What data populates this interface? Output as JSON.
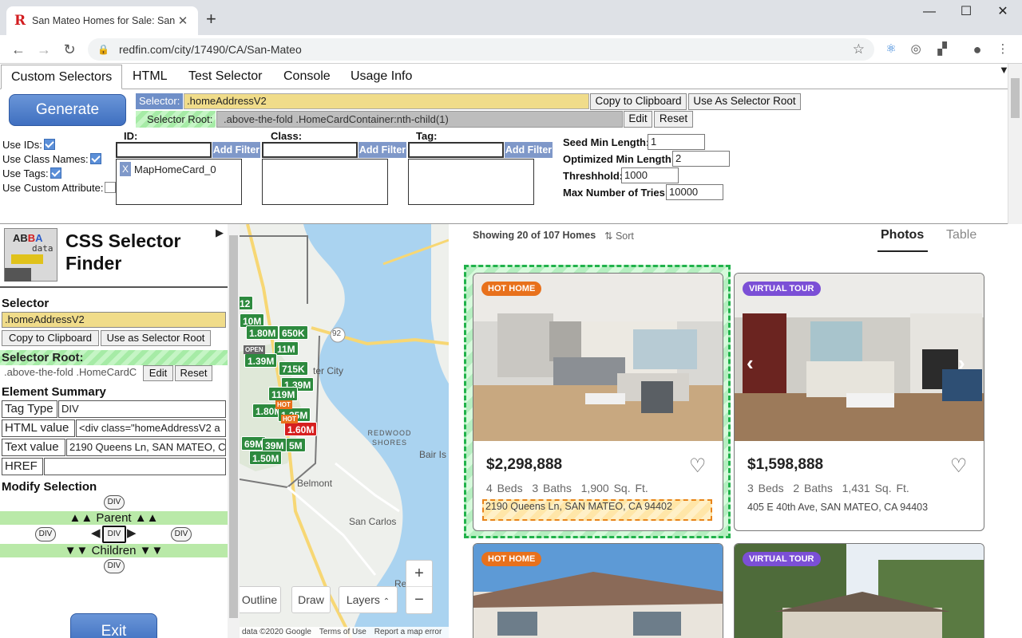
{
  "browser": {
    "tab_title": "San Mateo Homes for Sale: San M",
    "favicon": "R",
    "url": "redfin.com/city/17490/CA/San-Mateo"
  },
  "ext": {
    "tabs": [
      "Custom Selectors",
      "HTML",
      "Test Selector",
      "Console",
      "Usage Info"
    ],
    "generate_label": "Generate",
    "selector_label": "Selector:",
    "selector_value": ".homeAddressV2",
    "copy_label": "Copy to Clipboard",
    "use_root_label": "Use As Selector Root",
    "root_label": "Selector Root:",
    "root_value": ".above-the-fold .HomeCardContainer:nth-child(1)",
    "edit_label": "Edit",
    "reset_label": "Reset",
    "use_ids": "Use IDs:",
    "use_class_names": "Use Class Names:",
    "use_tags": "Use Tags:",
    "use_custom_attr": "Use Custom Attribute:",
    "id_header": "ID:",
    "class_header": "Class:",
    "tag_header": "Tag:",
    "add_filter": "Add Filter",
    "id_chip_x": "X",
    "id_chip": "MapHomeCard_0",
    "seed_min_label": "Seed Min Length:",
    "seed_min_value": "1",
    "opt_min_label": "Optimized Min Length:",
    "opt_min_value": "2",
    "threshold_label": "Threshhold:",
    "threshold_value": "1000",
    "max_tries_label": "Max Number of Tries:",
    "max_tries_value": "10000"
  },
  "finder": {
    "logo_a": "AB",
    "logo_b": "B",
    "logo_c": "A",
    "logo_data": "data",
    "title_line1": "CSS Selector",
    "title_line2": "Finder",
    "selector_head": "Selector",
    "selector_value": ".homeAddressV2",
    "copy_label": "Copy to Clipboard",
    "use_root_label": "Use as Selector Root",
    "root_head": "Selector Root:",
    "root_value": ".above-the-fold .HomeCardC",
    "edit_label": "Edit",
    "reset_label": "Reset",
    "summary_head": "Element Summary",
    "tag_type_label": "Tag Type",
    "tag_type_value": "DIV",
    "html_label": "HTML value",
    "html_value": "<div class=\"homeAddressV2 a",
    "text_label": "Text value",
    "text_value": "2190 Queens Ln, SAN MATEO, C",
    "href_label": "HREF",
    "href_value": "",
    "modify_head": "Modify Selection",
    "div": "DIV",
    "parent_label": "▲▲ Parent ▲▲",
    "children_label": "▼▼ Children ▼▼",
    "exit_label": "Exit"
  },
  "map": {
    "pins": [
      {
        "text": "10M",
        "red": false
      },
      {
        "text": "1.80M",
        "red": false
      },
      {
        "text": "650K",
        "red": false
      },
      {
        "text": "11M",
        "red": false
      },
      {
        "text": "1.39M",
        "red": false
      },
      {
        "text": "715K",
        "red": false
      },
      {
        "text": "1.39M",
        "red": false
      },
      {
        "text": "119M",
        "red": false
      },
      {
        "text": "1.80M",
        "red": false
      },
      {
        "text": "1.35M",
        "red": false
      },
      {
        "text": "1.60M",
        "red": true
      },
      {
        "text": "69M",
        "red": false
      },
      {
        "text": "39M",
        "red": false
      },
      {
        "text": "5M",
        "red": false
      },
      {
        "text": "1.50M",
        "red": false
      }
    ],
    "hot_tag": "HOT",
    "open_tag": "OPEN",
    "labels": {
      "foster_city": "ter City",
      "redwood_shores": "REDWOOD SHORES",
      "belmont": "Belmont",
      "san_carlos": "San Carlos",
      "bair_is": "Bair Is",
      "redwood_city": "Redwo",
      "route": "92"
    },
    "outline_label": "Outline",
    "draw_label": "Draw",
    "layers_label": "Layers",
    "zoom_in": "+",
    "zoom_out": "−",
    "footer": [
      "data ©2020 Google",
      "Terms of Use",
      "Report a map error"
    ]
  },
  "listings": {
    "showing": "Showing 20 of 107 Homes",
    "sort": "Sort",
    "tab_photos": "Photos",
    "tab_table": "Table",
    "cards": [
      {
        "badge": "HOT HOME",
        "price": "$2,298,888",
        "beds": "4 Beds",
        "baths": "3 Baths",
        "sqft": "1,900 Sq. Ft.",
        "address": "2190 Queens Ln, SAN MATEO, CA 94402"
      },
      {
        "badge": "VIRTUAL TOUR",
        "price": "$1,598,888",
        "beds": "3 Beds",
        "baths": "2 Baths",
        "sqft": "1,431 Sq. Ft.",
        "address": "405 E 40th Ave, SAN MATEO, CA 94403"
      },
      {
        "badge": "HOT HOME"
      },
      {
        "badge": "VIRTUAL TOUR"
      }
    ]
  },
  "colors": {
    "accent_blue": "#4a7bc8",
    "selector_yellow": "#f0dc8a",
    "root_green": "#a6eba6",
    "map_green": "#2d8a3e",
    "hot_badge": "#e8711c",
    "virtual_badge": "#7b4fd6"
  }
}
